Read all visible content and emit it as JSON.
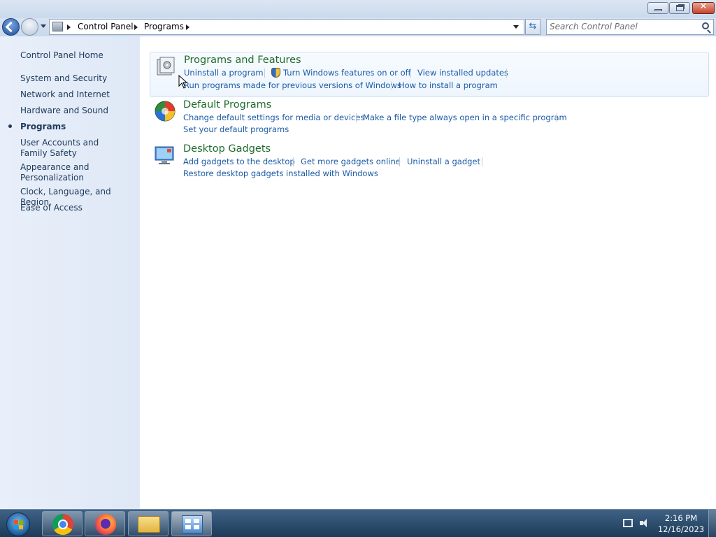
{
  "window": {
    "controls": {
      "minimize": "minimize",
      "maximize": "restore",
      "close": "close"
    }
  },
  "navigation": {
    "breadcrumbs": [
      "Control Panel",
      "Programs"
    ],
    "search_placeholder": "Search Control Panel"
  },
  "sidebar": {
    "home": "Control Panel Home",
    "items": [
      {
        "label": "System and Security",
        "active": false
      },
      {
        "label": "Network and Internet",
        "active": false
      },
      {
        "label": "Hardware and Sound",
        "active": false
      },
      {
        "label": "Programs",
        "active": true
      },
      {
        "label": "User Accounts and Family Safety",
        "active": false
      },
      {
        "label": "Appearance and Personalization",
        "active": false
      },
      {
        "label": "Clock, Language, and Region",
        "active": false
      },
      {
        "label": "Ease of Access",
        "active": false
      }
    ]
  },
  "categories": [
    {
      "title": "Programs and Features",
      "icon": "programs-features-icon",
      "tasks": [
        "Uninstall a program",
        "Turn Windows features on or off",
        "View installed updates",
        "Run programs made for previous versions of Windows",
        "How to install a program"
      ]
    },
    {
      "title": "Default Programs",
      "icon": "default-programs-icon",
      "tasks": [
        "Change default settings for media or devices",
        "Make a file type always open in a specific program",
        "Set your default programs"
      ]
    },
    {
      "title": "Desktop Gadgets",
      "icon": "desktop-gadgets-icon",
      "tasks": [
        "Add gadgets to the desktop",
        "Get more gadgets online",
        "Uninstall a gadget",
        "Restore desktop gadgets installed with Windows"
      ]
    }
  ],
  "taskbar": {
    "apps": [
      "chrome-icon",
      "firefox-icon",
      "folder-icon",
      "control-panel-icon"
    ],
    "clock": {
      "time": "2:16 PM",
      "date": "12/16/2023"
    }
  },
  "colors": {
    "category_title": "#1f6b2c",
    "link": "#1a5aa6",
    "sidebar_text": "#1e395b"
  }
}
